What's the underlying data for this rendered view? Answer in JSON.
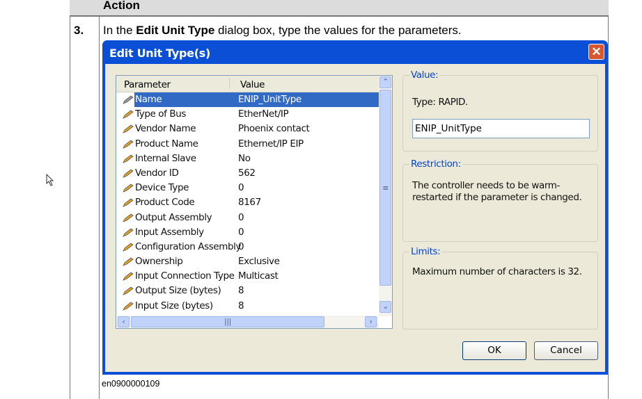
{
  "table": {
    "header": "Action",
    "step_number": "3.",
    "instruction_prefix": "In the ",
    "instruction_bold": "Edit Unit Type",
    "instruction_suffix": " dialog box, type the values for the parameters.",
    "caption": "en0900000109"
  },
  "dialog": {
    "title": "Edit Unit Type(s)",
    "columns": [
      "Parameter",
      "Value"
    ],
    "rows": [
      {
        "parameter": "Name",
        "value": "ENIP_UnitType"
      },
      {
        "parameter": "Type of Bus",
        "value": "EtherNet/IP"
      },
      {
        "parameter": "Vendor Name",
        "value": "Phoenix contact"
      },
      {
        "parameter": "Product Name",
        "value": "Ethernet/IP EIP"
      },
      {
        "parameter": "Internal Slave",
        "value": "No"
      },
      {
        "parameter": "Vendor ID",
        "value": "562"
      },
      {
        "parameter": "Device Type",
        "value": "0"
      },
      {
        "parameter": "Product Code",
        "value": "8167"
      },
      {
        "parameter": "Output Assembly",
        "value": "0"
      },
      {
        "parameter": "Input Assembly",
        "value": "0"
      },
      {
        "parameter": "Configuration Assembly",
        "value": "0"
      },
      {
        "parameter": "Ownership",
        "value": "Exclusive"
      },
      {
        "parameter": "Input Connection Type",
        "value": "Multicast"
      },
      {
        "parameter": "Output Size (bytes)",
        "value": "8"
      },
      {
        "parameter": "Input Size (bytes)",
        "value": "8"
      }
    ],
    "value_group": {
      "label": "Value:",
      "type_text": "Type: RAPID.",
      "input_value": "ENIP_UnitType"
    },
    "restriction_group": {
      "label": "Restriction:",
      "text": "The controller needs to be warm-restarted if the parameter is changed."
    },
    "limits_group": {
      "label": "Limits:",
      "text": "Maximum number of characters is 32."
    },
    "ok_label": "OK",
    "cancel_label": "Cancel",
    "close_glyph": "✕"
  }
}
